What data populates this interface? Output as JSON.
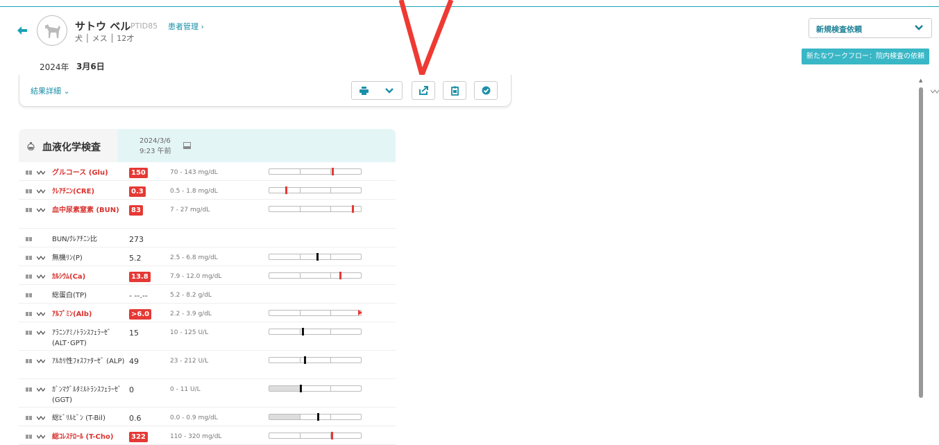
{
  "patient": {
    "name": "サトウ ベル",
    "id": "PTID85",
    "manage_link": "患者管理 ›",
    "info": "犬 │ メス │ 12才"
  },
  "date_tabs": {
    "year": "2024年",
    "day": "3月6日"
  },
  "order_select": {
    "value": "新規検査依頼"
  },
  "workflow_button": "新たなワークフロー：院内検査の依頼",
  "toolbar": {
    "detail_label": "結果詳細 ⌄"
  },
  "panel": {
    "title": "血液化学検査",
    "date": "2024/3/6",
    "time": "9:23 午前"
  },
  "colors": {
    "accent": "#1a8fa8",
    "abnormal": "#e53935",
    "header_bg": "#e4f5f6"
  },
  "results": [
    {
      "name": "グルコース (Glu)",
      "value": "150",
      "ref": "70 - 143 mg/dL",
      "abnormal": true,
      "has_trend": true,
      "marker": 0.69,
      "marker_type": "bar"
    },
    {
      "name": "ｸﾚｱﾁﾆﾝ(CRE)",
      "value": "0.3",
      "ref": "0.5 - 1.8 mg/dL",
      "abnormal": true,
      "has_trend": true,
      "marker": 0.18,
      "marker_type": "bar"
    },
    {
      "name": "血中尿素窒素 (BUN)",
      "value": "83",
      "ref": "7 - 27 mg/dL",
      "abnormal": true,
      "has_trend": true,
      "marker": 0.91,
      "marker_type": "bar"
    },
    {
      "name": "BUN/ｸﾚｱﾁﾆﾝ比",
      "value": "273",
      "ref": "",
      "abnormal": false,
      "has_trend": false,
      "marker": null,
      "marker_type": "none"
    },
    {
      "name": "無機ﾘﾝ(P)",
      "value": "5.2",
      "ref": "2.5 - 6.8 mg/dL",
      "abnormal": false,
      "has_trend": true,
      "marker": 0.52,
      "marker_type": "bar"
    },
    {
      "name": "ｶﾙｼｳﾑ(Ca)",
      "value": "13.8",
      "ref": "7.9 - 12.0 mg/dL",
      "abnormal": true,
      "has_trend": true,
      "marker": 0.77,
      "marker_type": "bar"
    },
    {
      "name": "総蛋白(TP)",
      "value": "- --.--",
      "ref": "5.2 - 8.2 g/dL",
      "abnormal": false,
      "has_trend": false,
      "marker": null,
      "marker_type": "none"
    },
    {
      "name": "ｱﾙﾌﾞﾐﾝ(Alb)",
      "value": ">6.0",
      "ref": "2.2 - 3.9 g/dL",
      "abnormal": true,
      "has_trend": true,
      "marker": 1.0,
      "marker_type": "arrow"
    },
    {
      "name": "ｱﾗﾆﾝｱﾐﾉﾄﾗﾝｽﾌｪﾗｰｾﾞ (ALT･GPT)",
      "value": "15",
      "ref": "10 - 125 U/L",
      "abnormal": false,
      "has_trend": true,
      "marker": 0.36,
      "marker_type": "bar"
    },
    {
      "name": "ｱﾙｶﾘ性ﾌｫｽﾌｧﾀｰｾﾞ (ALP)",
      "value": "49",
      "ref": "23 - 212 U/L",
      "abnormal": false,
      "has_trend": true,
      "marker": 0.39,
      "marker_type": "bar"
    },
    {
      "name": "ｶﾞﾝﾏｸﾞﾙﾀﾐﾙﾄﾗﾝｽﾌｪﾗｰｾﾞ(GGT)",
      "value": "0",
      "ref": "0 - 11 U/L",
      "abnormal": false,
      "has_trend": true,
      "marker": 0.34,
      "marker_type": "bar",
      "low_fill": 0.34
    },
    {
      "name": "総ﾋﾞﾘﾙﾋﾞﾝ (T-Bil)",
      "value": "0.6",
      "ref": "0.0 - 0.9 mg/dL",
      "abnormal": false,
      "has_trend": true,
      "marker": 0.53,
      "marker_type": "bar",
      "low_fill": 0.34
    },
    {
      "name": "総ｺﾚｽﾃﾛｰﾙ (T-Cho)",
      "value": "322",
      "ref": "110 - 320 mg/dL",
      "abnormal": true,
      "has_trend": true,
      "marker": 0.68,
      "marker_type": "bar"
    }
  ]
}
